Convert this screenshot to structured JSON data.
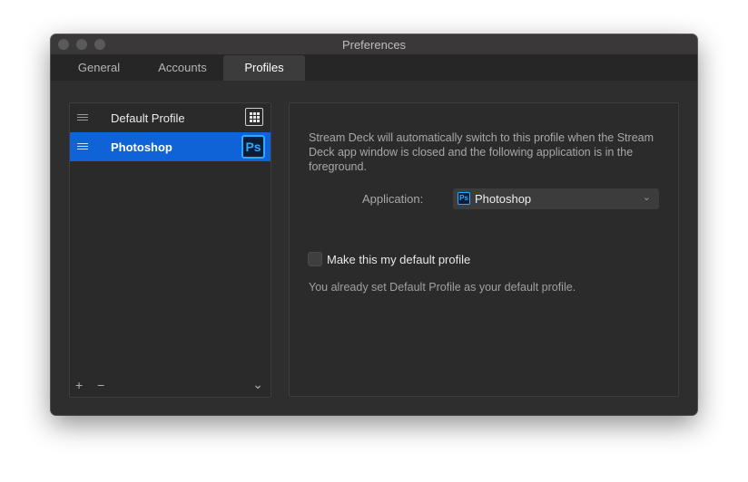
{
  "window": {
    "title": "Preferences"
  },
  "tabs": [
    {
      "label": "General",
      "active": false
    },
    {
      "label": "Accounts",
      "active": false
    },
    {
      "label": "Profiles",
      "active": true
    }
  ],
  "profiles": {
    "items": [
      {
        "name": "Default Profile",
        "icon": "grid-icon",
        "selected": false
      },
      {
        "name": "Photoshop",
        "icon": "photoshop-icon",
        "icon_text": "Ps",
        "selected": true
      }
    ],
    "footer": {
      "add_symbol": "+",
      "remove_symbol": "−",
      "menu_symbol": "⌄"
    }
  },
  "details": {
    "description": "Stream Deck will automatically switch to this profile when the Stream Deck app window is closed and the following application is in the foreground.",
    "application_label": "Application:",
    "application_value": "Photoshop",
    "application_icon_text": "Ps",
    "dropdown_symbol": "⌄",
    "default_checkbox_label": "Make this my default profile",
    "default_checkbox_checked": false,
    "note": "You already set Default Profile as your default profile."
  },
  "colors": {
    "selection": "#1063d6",
    "photoshop_blue": "#31a8ff",
    "window_bg": "#2f2f2f"
  }
}
